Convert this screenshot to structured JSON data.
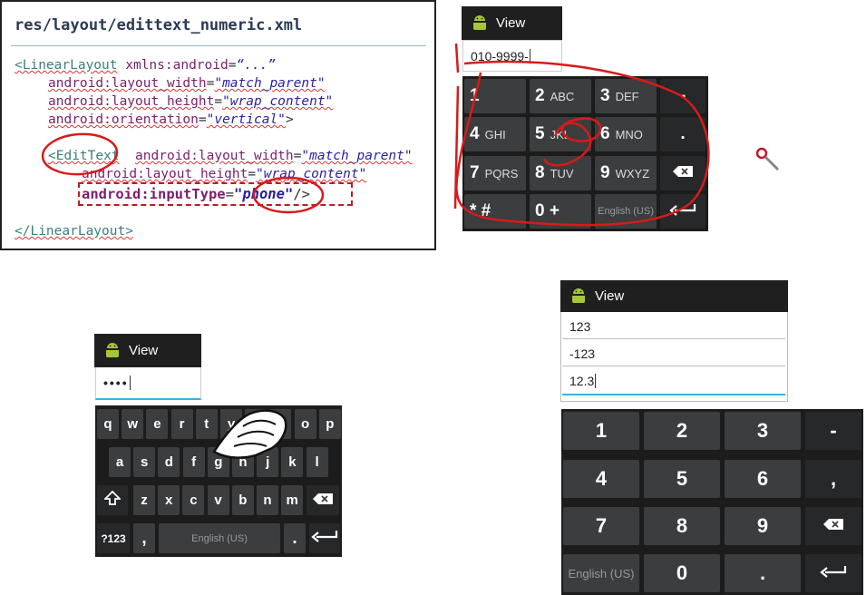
{
  "code": {
    "title": "res/layout/edittext_numeric.xml",
    "l1_tag": "<LinearLayout",
    "l1_attr": "xmlns:android",
    "l1_eq": "=",
    "l1_val": "“...”",
    "l2_attr": "android:layout_width",
    "l2_val": "\"match_parent\"",
    "l3_attr": "android:layout_height",
    "l3_val": "\"wrap_content\"",
    "l4_attr": "android:orientation",
    "l4_val": "\"vertical\"",
    "l4_end": ">",
    "l5_tag": "<EditText",
    "l5_attr": "android:layout_width",
    "l5_val": "\"match_parent\"",
    "l6_attr": "android:layout_height",
    "l6_val": "\"wrap_content\"",
    "l7_attr": "android:inputType",
    "l7_val": "\"phone\"",
    "l7_end": "/>",
    "l8_tag": "</LinearLayout>"
  },
  "phone_screen": {
    "title": "View",
    "field_value": "010-9999-",
    "keys": [
      {
        "main": "1",
        "sub": ""
      },
      {
        "main": "2",
        "sub": "ABC"
      },
      {
        "main": "3",
        "sub": "DEF"
      },
      {
        "main": "-",
        "sub": ""
      },
      {
        "main": "4",
        "sub": "GHI"
      },
      {
        "main": "5",
        "sub": "JKL"
      },
      {
        "main": "6",
        "sub": "MNO"
      },
      {
        "main": ".",
        "sub": ""
      },
      {
        "main": "7",
        "sub": "PQRS"
      },
      {
        "main": "8",
        "sub": "TUV"
      },
      {
        "main": "9",
        "sub": "WXYZ"
      },
      {
        "main": "",
        "sub": "backspace-icon"
      },
      {
        "main": "* #",
        "sub": ""
      },
      {
        "main": "0 +",
        "sub": ""
      },
      {
        "main": "English (US)",
        "sub": ""
      },
      {
        "main": "",
        "sub": "enter-icon"
      }
    ]
  },
  "password_screen": {
    "title": "View",
    "field_value": "••••",
    "row1": [
      "q",
      "w",
      "e",
      "r",
      "t",
      "y",
      "u",
      "i",
      "o",
      "p"
    ],
    "row2": [
      "a",
      "s",
      "d",
      "f",
      "g",
      "h",
      "j",
      "k",
      "l"
    ],
    "row3": [
      "z",
      "x",
      "c",
      "v",
      "b",
      "n",
      "m"
    ],
    "sym_label": "?123",
    "comma": ",",
    "space_label": "English (US)",
    "period": "."
  },
  "numeric_screen": {
    "title": "View",
    "fields": [
      "123",
      "-123",
      "12.3"
    ],
    "keys": [
      "1",
      "2",
      "3",
      "-",
      "4",
      "5",
      "6",
      ",",
      "7",
      "8",
      "9",
      "",
      "English (US)",
      "0",
      ".",
      ""
    ]
  },
  "colors": {
    "accent": "#33b5e5",
    "annotation": "#d81a1a",
    "android_green": "#a4c639"
  }
}
